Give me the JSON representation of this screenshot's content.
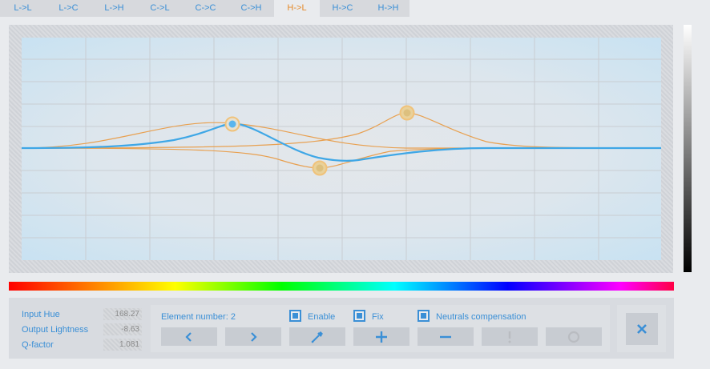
{
  "tabs": [
    {
      "label": "L->L"
    },
    {
      "label": "L->C"
    },
    {
      "label": "L->H"
    },
    {
      "label": "C->L"
    },
    {
      "label": "C->C"
    },
    {
      "label": "C->H"
    },
    {
      "label": "H->L",
      "active": true
    },
    {
      "label": "H->C"
    },
    {
      "label": "H->H"
    }
  ],
  "params": {
    "input_hue_label": "Input Hue",
    "input_hue_value": "168.27",
    "output_lightness_label": "Output Lightness",
    "output_lightness_value": "-8.63",
    "q_factor_label": "Q-factor",
    "q_factor_value": "1.081"
  },
  "element": {
    "number_label": "Element number: 2"
  },
  "checkboxes": {
    "enable_label": "Enable",
    "fix_label": "Fix",
    "neutrals_label": "Neutrals compensation"
  },
  "buttons": {
    "prev_icon": "chevron-left-icon",
    "next_icon": "chevron-right-icon",
    "picker_icon": "eyedropper-icon",
    "add_icon": "plus-icon",
    "remove_icon": "minus-icon",
    "warn_icon": "exclamation-icon",
    "reset_icon": "circle-icon",
    "close_icon": "close-icon"
  },
  "colors": {
    "accent": "#3a8fd6",
    "active_tab": "#e58a2a",
    "curve_main": "#3fa7e6",
    "curve_elements": "#e8a050"
  }
}
